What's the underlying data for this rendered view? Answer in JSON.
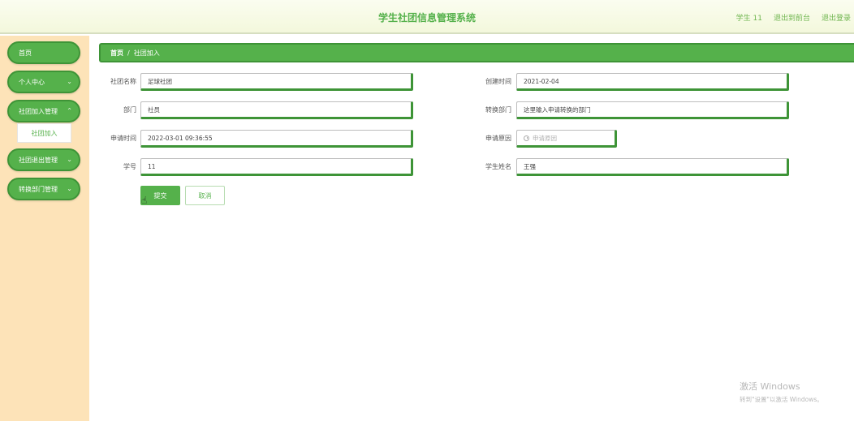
{
  "header": {
    "title": "学生社团信息管理系统",
    "user": "学生 11",
    "to_front": "退出到前台",
    "logout": "退出登录"
  },
  "sidebar": {
    "items": [
      {
        "label": "首页",
        "has_chevron": false
      },
      {
        "label": "个人中心",
        "has_chevron": true
      },
      {
        "label": "社团加入管理",
        "has_chevron": true
      },
      {
        "label": "社团退出管理",
        "has_chevron": true
      },
      {
        "label": "转换部门管理",
        "has_chevron": true
      }
    ],
    "sub_item": "社团加入"
  },
  "breadcrumb": {
    "home": "首页",
    "separator": "/",
    "current": "社团加入"
  },
  "form": {
    "club_name": {
      "label": "社团名称",
      "value": "足球社团"
    },
    "create_time": {
      "label": "创建时间",
      "value": "2021-02-04"
    },
    "department": {
      "label": "部门",
      "value": "社员"
    },
    "transfer_dept": {
      "label": "转换部门",
      "value": "这里输入申请转换的部门"
    },
    "apply_time": {
      "label": "申请时间",
      "value": "2022-03-01 09:36:55"
    },
    "apply_reason": {
      "label": "申请原因",
      "placeholder": "申请原因"
    },
    "student_no": {
      "label": "学号",
      "value": "11"
    },
    "student_name": {
      "label": "学生姓名",
      "value": "王强"
    }
  },
  "buttons": {
    "submit": "提交",
    "cancel": "取消"
  },
  "watermark": {
    "line1": "激活 Windows",
    "line2": "转到\"设置\"以激活 Windows。"
  },
  "colors": {
    "accent": "#55b14b",
    "accent_dark": "#3e9437",
    "sidebar_bg": "#fde3b8",
    "header_bg": "#f3f8dc"
  }
}
